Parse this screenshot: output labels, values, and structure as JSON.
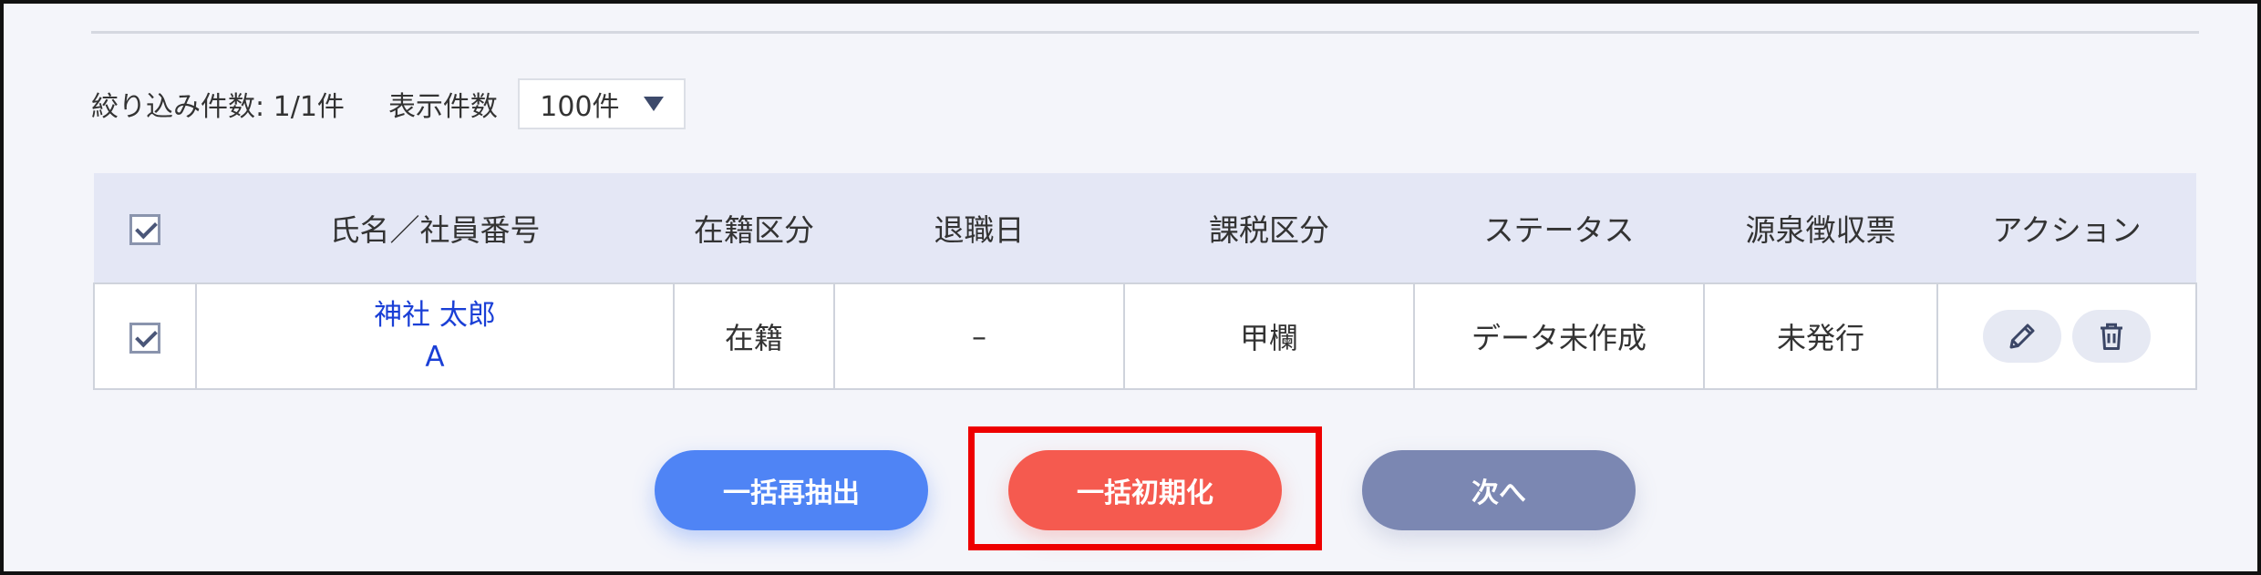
{
  "filter": {
    "count_text": "絞り込み件数: 1/1件",
    "per_page_label": "表示件数",
    "per_page_value": "100件"
  },
  "table": {
    "headers": [
      "氏名／社員番号",
      "在籍区分",
      "退職日",
      "課税区分",
      "ステータス",
      "源泉徴収票",
      "アクション"
    ],
    "rows": [
      {
        "checked": true,
        "name": "神社 太郎",
        "employee_no": "A",
        "enrollment": "在籍",
        "retirement_date": "–",
        "tax_category": "甲欄",
        "status": "データ未作成",
        "withholding_slip": "未発行"
      }
    ],
    "header_checked": true
  },
  "icons": {
    "edit": "pencil-icon",
    "delete": "trash-icon",
    "dropdown": "caret-down-icon",
    "checkbox": "check-icon"
  },
  "buttons": {
    "bulk_reextract": "一括再抽出",
    "bulk_reset": "一括初期化",
    "next": "次へ"
  },
  "colors": {
    "primary_blue": "#4f84f5",
    "danger_red": "#f55a4f",
    "next_gray": "#7b87b2",
    "highlight": "#ee0000",
    "link_blue": "#1a3fd6"
  }
}
